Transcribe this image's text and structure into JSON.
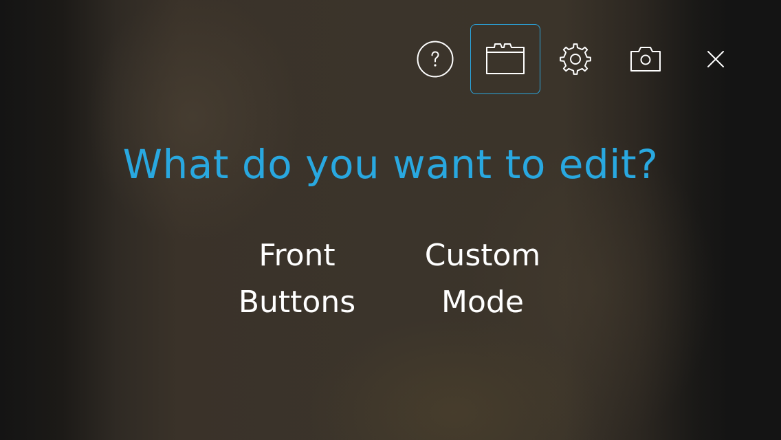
{
  "title": "What do you want to edit?",
  "toolbar": {
    "accent_color": "#2aa7e0",
    "active": "presets",
    "buttons": [
      {
        "name": "help",
        "icon": "help-circle-icon"
      },
      {
        "name": "presets",
        "icon": "folder-icon"
      },
      {
        "name": "settings",
        "icon": "gear-icon"
      },
      {
        "name": "camera",
        "icon": "camera-icon"
      },
      {
        "name": "close",
        "icon": "close-icon"
      }
    ]
  },
  "options": [
    {
      "line1": "Front",
      "line2": "Buttons"
    },
    {
      "line1": "Custom",
      "line2": "Mode"
    }
  ]
}
